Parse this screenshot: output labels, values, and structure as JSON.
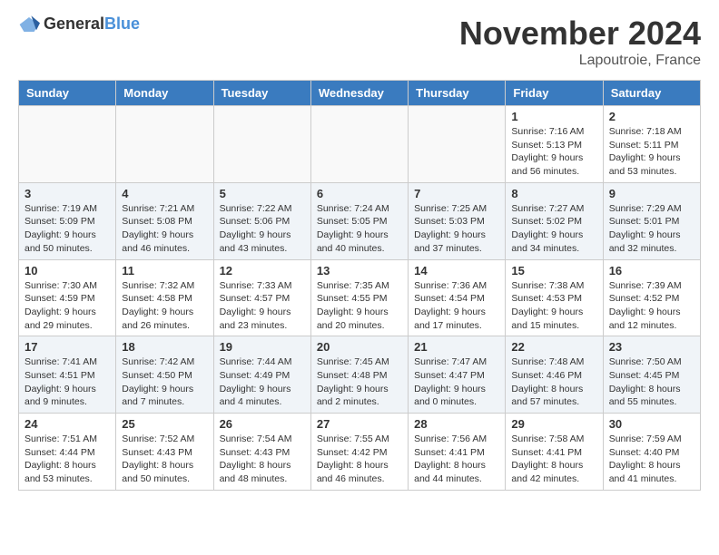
{
  "logo": {
    "general": "General",
    "blue": "Blue"
  },
  "title": "November 2024",
  "location": "Lapoutroie, France",
  "headers": [
    "Sunday",
    "Monday",
    "Tuesday",
    "Wednesday",
    "Thursday",
    "Friday",
    "Saturday"
  ],
  "weeks": [
    [
      {
        "day": "",
        "info": ""
      },
      {
        "day": "",
        "info": ""
      },
      {
        "day": "",
        "info": ""
      },
      {
        "day": "",
        "info": ""
      },
      {
        "day": "",
        "info": ""
      },
      {
        "day": "1",
        "info": "Sunrise: 7:16 AM\nSunset: 5:13 PM\nDaylight: 9 hours and 56 minutes."
      },
      {
        "day": "2",
        "info": "Sunrise: 7:18 AM\nSunset: 5:11 PM\nDaylight: 9 hours and 53 minutes."
      }
    ],
    [
      {
        "day": "3",
        "info": "Sunrise: 7:19 AM\nSunset: 5:09 PM\nDaylight: 9 hours and 50 minutes."
      },
      {
        "day": "4",
        "info": "Sunrise: 7:21 AM\nSunset: 5:08 PM\nDaylight: 9 hours and 46 minutes."
      },
      {
        "day": "5",
        "info": "Sunrise: 7:22 AM\nSunset: 5:06 PM\nDaylight: 9 hours and 43 minutes."
      },
      {
        "day": "6",
        "info": "Sunrise: 7:24 AM\nSunset: 5:05 PM\nDaylight: 9 hours and 40 minutes."
      },
      {
        "day": "7",
        "info": "Sunrise: 7:25 AM\nSunset: 5:03 PM\nDaylight: 9 hours and 37 minutes."
      },
      {
        "day": "8",
        "info": "Sunrise: 7:27 AM\nSunset: 5:02 PM\nDaylight: 9 hours and 34 minutes."
      },
      {
        "day": "9",
        "info": "Sunrise: 7:29 AM\nSunset: 5:01 PM\nDaylight: 9 hours and 32 minutes."
      }
    ],
    [
      {
        "day": "10",
        "info": "Sunrise: 7:30 AM\nSunset: 4:59 PM\nDaylight: 9 hours and 29 minutes."
      },
      {
        "day": "11",
        "info": "Sunrise: 7:32 AM\nSunset: 4:58 PM\nDaylight: 9 hours and 26 minutes."
      },
      {
        "day": "12",
        "info": "Sunrise: 7:33 AM\nSunset: 4:57 PM\nDaylight: 9 hours and 23 minutes."
      },
      {
        "day": "13",
        "info": "Sunrise: 7:35 AM\nSunset: 4:55 PM\nDaylight: 9 hours and 20 minutes."
      },
      {
        "day": "14",
        "info": "Sunrise: 7:36 AM\nSunset: 4:54 PM\nDaylight: 9 hours and 17 minutes."
      },
      {
        "day": "15",
        "info": "Sunrise: 7:38 AM\nSunset: 4:53 PM\nDaylight: 9 hours and 15 minutes."
      },
      {
        "day": "16",
        "info": "Sunrise: 7:39 AM\nSunset: 4:52 PM\nDaylight: 9 hours and 12 minutes."
      }
    ],
    [
      {
        "day": "17",
        "info": "Sunrise: 7:41 AM\nSunset: 4:51 PM\nDaylight: 9 hours and 9 minutes."
      },
      {
        "day": "18",
        "info": "Sunrise: 7:42 AM\nSunset: 4:50 PM\nDaylight: 9 hours and 7 minutes."
      },
      {
        "day": "19",
        "info": "Sunrise: 7:44 AM\nSunset: 4:49 PM\nDaylight: 9 hours and 4 minutes."
      },
      {
        "day": "20",
        "info": "Sunrise: 7:45 AM\nSunset: 4:48 PM\nDaylight: 9 hours and 2 minutes."
      },
      {
        "day": "21",
        "info": "Sunrise: 7:47 AM\nSunset: 4:47 PM\nDaylight: 9 hours and 0 minutes."
      },
      {
        "day": "22",
        "info": "Sunrise: 7:48 AM\nSunset: 4:46 PM\nDaylight: 8 hours and 57 minutes."
      },
      {
        "day": "23",
        "info": "Sunrise: 7:50 AM\nSunset: 4:45 PM\nDaylight: 8 hours and 55 minutes."
      }
    ],
    [
      {
        "day": "24",
        "info": "Sunrise: 7:51 AM\nSunset: 4:44 PM\nDaylight: 8 hours and 53 minutes."
      },
      {
        "day": "25",
        "info": "Sunrise: 7:52 AM\nSunset: 4:43 PM\nDaylight: 8 hours and 50 minutes."
      },
      {
        "day": "26",
        "info": "Sunrise: 7:54 AM\nSunset: 4:43 PM\nDaylight: 8 hours and 48 minutes."
      },
      {
        "day": "27",
        "info": "Sunrise: 7:55 AM\nSunset: 4:42 PM\nDaylight: 8 hours and 46 minutes."
      },
      {
        "day": "28",
        "info": "Sunrise: 7:56 AM\nSunset: 4:41 PM\nDaylight: 8 hours and 44 minutes."
      },
      {
        "day": "29",
        "info": "Sunrise: 7:58 AM\nSunset: 4:41 PM\nDaylight: 8 hours and 42 minutes."
      },
      {
        "day": "30",
        "info": "Sunrise: 7:59 AM\nSunset: 4:40 PM\nDaylight: 8 hours and 41 minutes."
      }
    ]
  ]
}
